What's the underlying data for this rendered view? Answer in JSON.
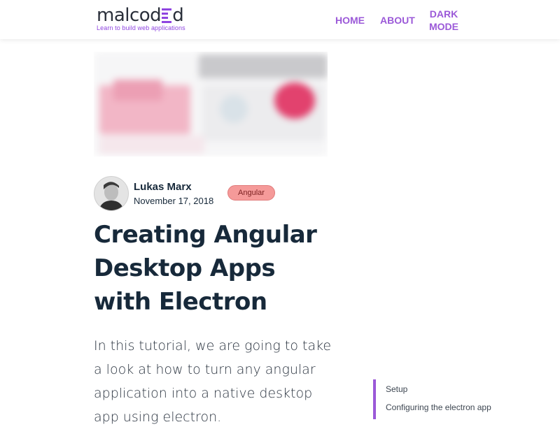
{
  "header": {
    "logo": {
      "text_before": "malcod",
      "text_after": "d",
      "tagline": "Learn to build web applications"
    },
    "nav": [
      {
        "label": "HOME"
      },
      {
        "label": "ABOUT"
      },
      {
        "label_line1": "DARK",
        "label_line2": "MODE"
      }
    ]
  },
  "article": {
    "author": "Lukas Marx",
    "date": "November 17, 2018",
    "tag": "Angular",
    "title": "Creating Angular Desktop Apps with Electron",
    "intro": "In this tutorial, we are going to take a look at how to turn any angular application into a native desktop app using electron."
  },
  "toc": {
    "items": [
      "Setup",
      "Configuring the electron app"
    ]
  },
  "colors": {
    "accent": "#9b59d8",
    "tag_bg": "#f59a99",
    "text": "#17293a"
  }
}
